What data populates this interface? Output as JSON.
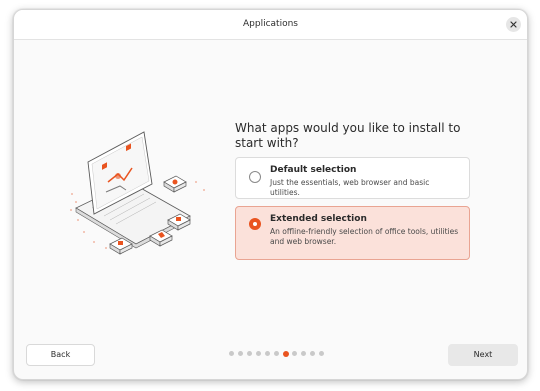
{
  "window": {
    "title": "Applications"
  },
  "page": {
    "question": "What apps would you like to install to start with?",
    "options": [
      {
        "title": "Default selection",
        "description": "Just the essentials, web browser and basic utilities.",
        "selected": false
      },
      {
        "title": "Extended selection",
        "description": "An offline-friendly selection of office tools, utilities and web browser.",
        "selected": true
      }
    ]
  },
  "footer": {
    "back_label": "Back",
    "next_label": "Next",
    "steps_total": 11,
    "steps_current": 7
  },
  "colors": {
    "accent": "#e95420",
    "selected_bg": "#fbe1da",
    "selected_border": "#e9a492"
  },
  "icons": [
    "close-icon",
    "laptop-illustration"
  ]
}
